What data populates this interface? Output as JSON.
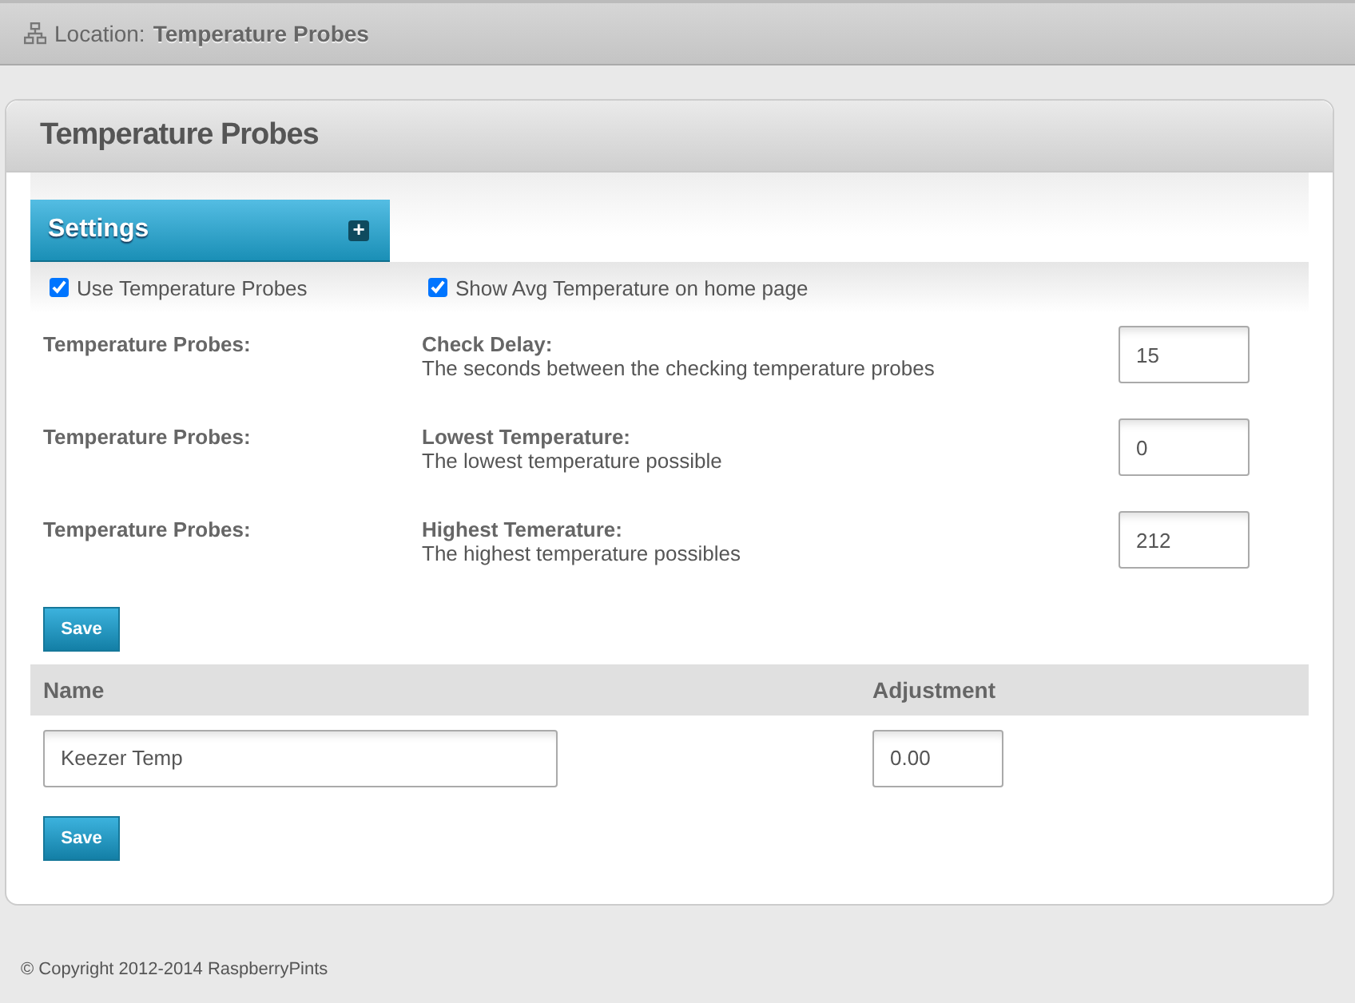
{
  "location": {
    "label": "Location:",
    "page": "Temperature Probes"
  },
  "panel": {
    "title": "Temperature Probes"
  },
  "settings": {
    "title": "Settings",
    "expand_icon": "+",
    "checkboxes": [
      {
        "label": "Use Temperature Probes",
        "checked": true
      },
      {
        "label": "Show Avg Temperature on home page",
        "checked": true
      }
    ],
    "rows": [
      {
        "group": "Temperature Probes:",
        "name": "Check Delay:",
        "description": "The seconds between the checking temperature probes",
        "value": "15"
      },
      {
        "group": "Temperature Probes:",
        "name": "Lowest Temperature:",
        "description": "The lowest temperature possible",
        "value": "0"
      },
      {
        "group": "Temperature Probes:",
        "name": "Highest Temerature:",
        "description": "The highest temperature possibles",
        "value": "212"
      }
    ],
    "save": "Save"
  },
  "probes": {
    "columns": [
      "Name",
      "Adjustment"
    ],
    "rows": [
      {
        "name": "Keezer Temp",
        "adjustment": "0.00"
      }
    ],
    "save": "Save"
  },
  "footer": "© Copyright 2012-2014 RaspberryPints"
}
